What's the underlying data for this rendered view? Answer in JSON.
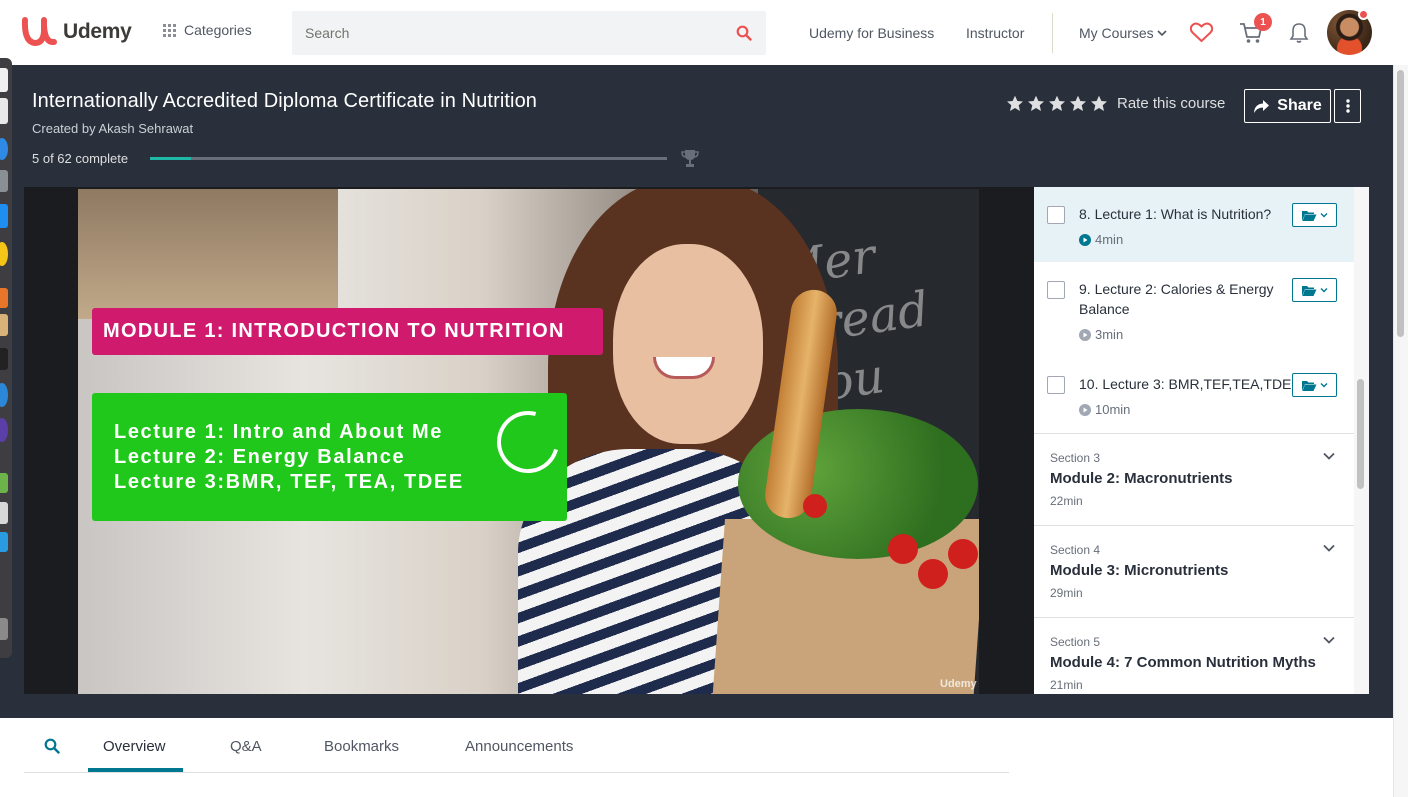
{
  "nav": {
    "logo_text": "Udemy",
    "categories_label": "Categories",
    "search_placeholder": "Search",
    "udemy_for_business": "Udemy for Business",
    "instructor": "Instructor",
    "my_courses": "My Courses",
    "cart_count": "1",
    "brand_color": "#ec5252"
  },
  "course": {
    "title": "Internationally Accredited Diploma Certificate in Nutrition",
    "created_by": "Created by Akash Sehrawat",
    "progress_text": "5 of 62 complete",
    "progress_fraction": 0.08,
    "rate_label": "Rate this course",
    "share_label": "Share",
    "star_count": 5
  },
  "video": {
    "module_banner": "MODULE 1: INTRODUCTION TO NUTRITION",
    "lecture_lines": [
      "Lecture 1: Intro and About Me",
      "Lecture 2: Energy Balance",
      "Lecture 3:BMR, TEF, TEA, TDEE"
    ],
    "chalkboard_text": "Mer\nBread\nSou",
    "watermark": "Udemy"
  },
  "curriculum": {
    "lectures": [
      {
        "title": "8. Lecture 1: What is Nutrition?",
        "duration": "4min",
        "active": true
      },
      {
        "title": "9. Lecture 2: Calories & Energy Balance",
        "duration": "3min",
        "active": false
      },
      {
        "title": "10. Lecture 3: BMR,TEF,TEA,TDEE",
        "duration": "10min",
        "active": false
      }
    ],
    "sections": [
      {
        "label": "Section 3",
        "title": "Module 2: Macronutrients",
        "duration": "22min"
      },
      {
        "label": "Section 4",
        "title": "Module 3: Micronutrients",
        "duration": "29min"
      },
      {
        "label": "Section 5",
        "title": "Module 4: 7 Common Nutrition Myths",
        "duration": "21min"
      }
    ]
  },
  "tabs": {
    "items": [
      "Overview",
      "Q&A",
      "Bookmarks",
      "Announcements"
    ],
    "active": "Overview"
  }
}
